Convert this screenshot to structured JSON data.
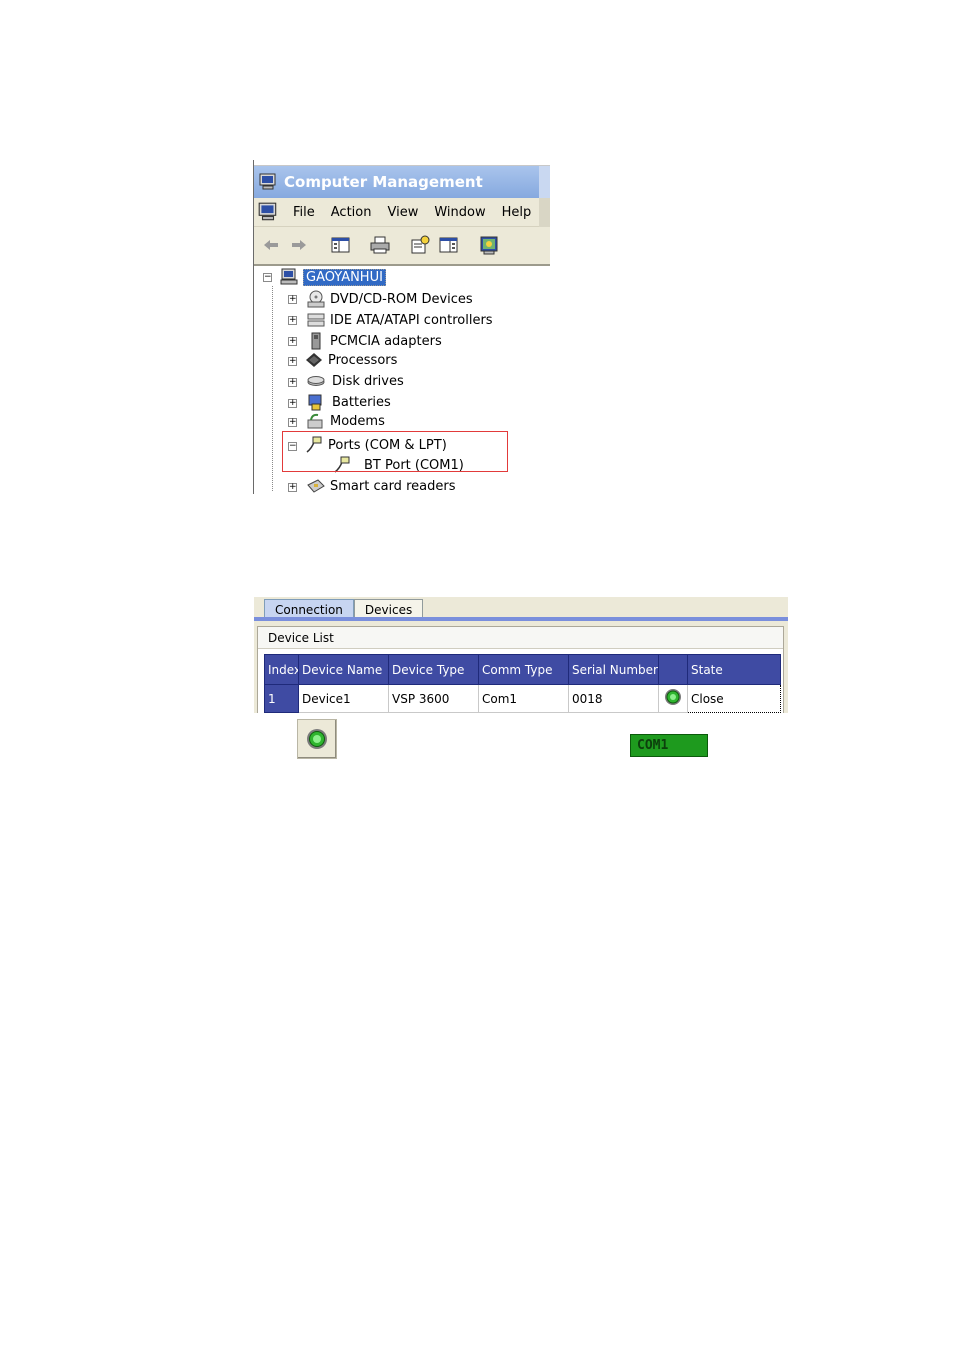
{
  "computer_management": {
    "title": "Computer Management",
    "menu": [
      "File",
      "Action",
      "View",
      "Window",
      "Help"
    ],
    "toolbar_icons": [
      "back-arrow-icon",
      "forward-arrow-icon",
      "show-hide-tree-icon",
      "print-icon",
      "properties-icon",
      "help-pane-icon",
      "computer-screen-icon"
    ],
    "tree": {
      "root": "GAOYANHUI",
      "items": [
        {
          "label": "DVD/CD-ROM Devices",
          "icon": "cd-drive-icon"
        },
        {
          "label": "IDE ATA/ATAPI  controllers",
          "icon": "ide-controller-icon"
        },
        {
          "label": "PCMCIA adapters",
          "icon": "pcmcia-icon"
        },
        {
          "label": "Processors",
          "icon": "processor-icon"
        },
        {
          "label": "Disk drives",
          "icon": "disk-drive-icon"
        },
        {
          "label": "Batteries",
          "icon": "battery-icon"
        },
        {
          "label": "Modems",
          "icon": "modem-icon"
        },
        {
          "label": "Ports (COM  &  LPT)",
          "icon": "port-icon"
        },
        {
          "label": "BT Port   (COM1)",
          "icon": "port-icon"
        },
        {
          "label": "Smart card readers",
          "icon": "smart-card-icon"
        }
      ]
    }
  },
  "connection_panel": {
    "tabs": [
      "Connection",
      "Devices"
    ],
    "device_list_title": "Device List",
    "columns": [
      "Index",
      "Device Name",
      "Device Type",
      "Comm Type",
      "Serial Number",
      "",
      "State"
    ],
    "rows": [
      {
        "index": "1",
        "device_name": "Device1",
        "device_type": "VSP 3600",
        "comm_type": "Com1",
        "serial_number": "0018",
        "status_icon": "green-led-icon",
        "state": "Close"
      }
    ]
  },
  "widgets": {
    "led_button_icon": "green-led-icon",
    "com_badge": "COM1",
    "com_badge_color": "#1e9a1e"
  }
}
